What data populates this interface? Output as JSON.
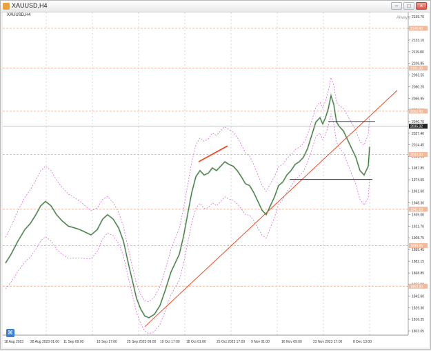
{
  "window": {
    "title": "XAUUSD,H4",
    "controls": {
      "minimize": "–",
      "restore": "□",
      "close": "×"
    }
  },
  "chart": {
    "symbol_label": "XAUUSD,H4",
    "algo_label": "Always",
    "colors": {
      "price": "#2f7d32",
      "raw_price": "#b8b8b8",
      "bands": "#d96ad9",
      "levels": "#f4a57f",
      "trendline": "#f24a24",
      "small_trend": "#f24a24",
      "box_lines": "#1f2a44",
      "grid": "#c7c7c7",
      "level_tag": "#f4b999"
    },
    "price_axis": {
      "ticks": [
        "2159.70",
        "2146.40",
        "2133.10",
        "2119.80",
        "2106.85",
        "2093.55",
        "2080.25",
        "2066.95",
        "2054.00",
        "2040.70",
        "2027.40",
        "2014.45",
        "2001.15",
        "1987.85",
        "1974.55",
        "1961.60",
        "1948.30",
        "1935.00",
        "1921.70",
        "1908.75",
        "1895.45",
        "1882.15",
        "1868.85",
        "1855.90",
        "1842.60",
        "1829.30",
        "1816.35",
        "1803.05"
      ],
      "current_price": "2035.32",
      "level_tags": [
        "2146.40",
        "2101.30",
        "2052.40",
        "2003.30",
        "1941.10",
        "1899.85",
        "1853.80"
      ]
    },
    "time_axis": {
      "labels": [
        "18 Aug 2023",
        "28 Aug 2023 01:00",
        "11 Sep 09:00",
        "18 Sep 17:00",
        "25 Sep 2023 09:00",
        "10 Oct 17:00",
        "18 Oct 01:00",
        "25 Oct 2023 17:00",
        "9 Nov 01:00",
        "16 Nov 09:00",
        "23 Nov 2023 17:00",
        "8 Dec 13:00"
      ]
    }
  }
}
